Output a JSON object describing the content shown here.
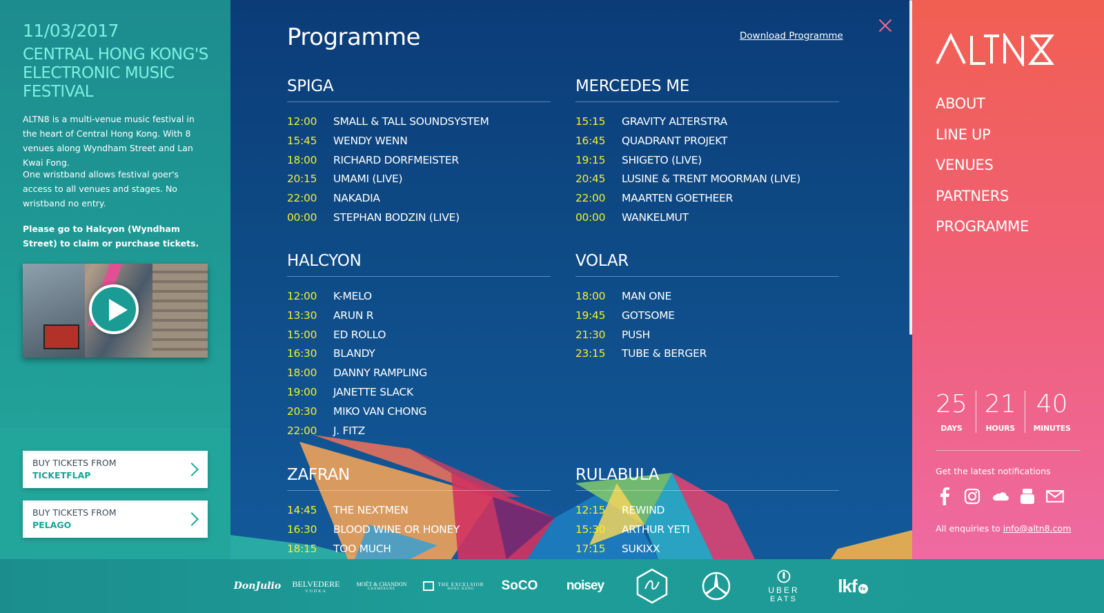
{
  "left": {
    "date": "11/03/2017",
    "headline": "CENTRAL HONG KONG'S ELECTRONIC MUSIC FESTIVAL",
    "desc1": "ALTN8 is a multi-venue music festival in the heart of Central Hong Kong. With 8 venues along Wyndham Street and Lan Kwai Fong.",
    "desc2": "One wristband allows festival goer's access to all venues and stages. No wristband no entry.",
    "desc3": "Please go to Halcyon (Wyndham Street) to claim or purchase tickets.",
    "tickets": [
      {
        "line1": "BUY TICKETS FROM",
        "line2": "TICKETFLAP"
      },
      {
        "line1": "BUY TICKETS FROM",
        "line2": "PELAGO"
      }
    ]
  },
  "main": {
    "title": "Programme",
    "download": "Download Programme",
    "venues": {
      "spiga": {
        "name": "SPIGA",
        "slots": [
          {
            "time": "12:00",
            "act": "SMALL & TALL SOUNDSYSTEM"
          },
          {
            "time": "15:45",
            "act": "WENDY WENN"
          },
          {
            "time": "18:00",
            "act": "RICHARD DORFMEISTER"
          },
          {
            "time": "20:15",
            "act": "UMAMI (LIVE)"
          },
          {
            "time": "22:00",
            "act": "NAKADIA"
          },
          {
            "time": "00:00",
            "act": "STEPHAN BODZIN (LIVE)"
          }
        ]
      },
      "mercedes": {
        "name": "MERCEDES ME",
        "slots": [
          {
            "time": "15:15",
            "act": "GRAVITY ALTERSTRA"
          },
          {
            "time": "16:45",
            "act": "QUADRANT PROJEKT"
          },
          {
            "time": "19:15",
            "act": "SHIGETO (LIVE)"
          },
          {
            "time": "20:45",
            "act": "LUSINE & TRENT MOORMAN (LIVE)"
          },
          {
            "time": "22:00",
            "act": "MAARTEN GOETHEER"
          },
          {
            "time": "00:00",
            "act": "WANKELMUT"
          }
        ]
      },
      "halcyon": {
        "name": "HALCYON",
        "slots": [
          {
            "time": "12:00",
            "act": "K-MELO"
          },
          {
            "time": "13:30",
            "act": "ARUN R"
          },
          {
            "time": "15:00",
            "act": "ED ROLLO"
          },
          {
            "time": "16:30",
            "act": "BLANDY"
          },
          {
            "time": "18:00",
            "act": "DANNY RAMPLING"
          },
          {
            "time": "19:00",
            "act": "JANETTE SLACK"
          },
          {
            "time": "20:30",
            "act": "MIKO VAN CHONG"
          },
          {
            "time": "22:00",
            "act": "J. FITZ"
          }
        ]
      },
      "volar": {
        "name": "VOLAR",
        "slots": [
          {
            "time": "18:00",
            "act": "MAN ONE"
          },
          {
            "time": "19:45",
            "act": "GOTSOME"
          },
          {
            "time": "21:30",
            "act": "PUSH"
          },
          {
            "time": "23:15",
            "act": "TUBE & BERGER"
          }
        ]
      },
      "zafran": {
        "name": "ZAFRAN",
        "slots": [
          {
            "time": "14:45",
            "act": "THE NEXTMEN"
          },
          {
            "time": "16:30",
            "act": "BLOOD WINE OR HONEY"
          },
          {
            "time": "18:15",
            "act": "TOO MUCH"
          }
        ]
      },
      "rulabula": {
        "name": "RULABULA",
        "slots": [
          {
            "time": "12:15",
            "act": "REWIND"
          },
          {
            "time": "15:30",
            "act": "ARTHUR YETI"
          },
          {
            "time": "17:15",
            "act": "SUKIXX"
          }
        ]
      }
    }
  },
  "right": {
    "logo_text": "ALTN8",
    "menu": [
      "ABOUT",
      "LINE UP",
      "VENUES",
      "PARTNERS",
      "PROGRAMME"
    ],
    "countdown": [
      {
        "num": "25",
        "label": "DAYS"
      },
      {
        "num": "21",
        "label": "HOURS"
      },
      {
        "num": "40",
        "label": "MINUTES"
      }
    ],
    "notify": "Get the latest notifications",
    "enquiry_prefix": "All enquiries to ",
    "enquiry_email": "info@altn8.com",
    "social_icons": [
      "facebook-icon",
      "instagram-icon",
      "soundcloud-icon",
      "youtube-icon",
      "mail-icon"
    ]
  },
  "footer": {
    "sponsors": [
      "DonJulio",
      "BELVEDERE",
      "VODKA",
      "MOËT & CHANDON",
      "CHAMPAGNE",
      "THE EXCELSIOR",
      "HONG KONG",
      "SoCO",
      "noisey",
      "UBER",
      "EATS",
      "lkf",
      "tv"
    ]
  },
  "colors": {
    "left_bg": "#1f9a95",
    "main_bg": "#0e4b86",
    "right_bg": "#f0607a",
    "time_yellow": "#f1f02f",
    "accent_teal": "#18a396"
  }
}
